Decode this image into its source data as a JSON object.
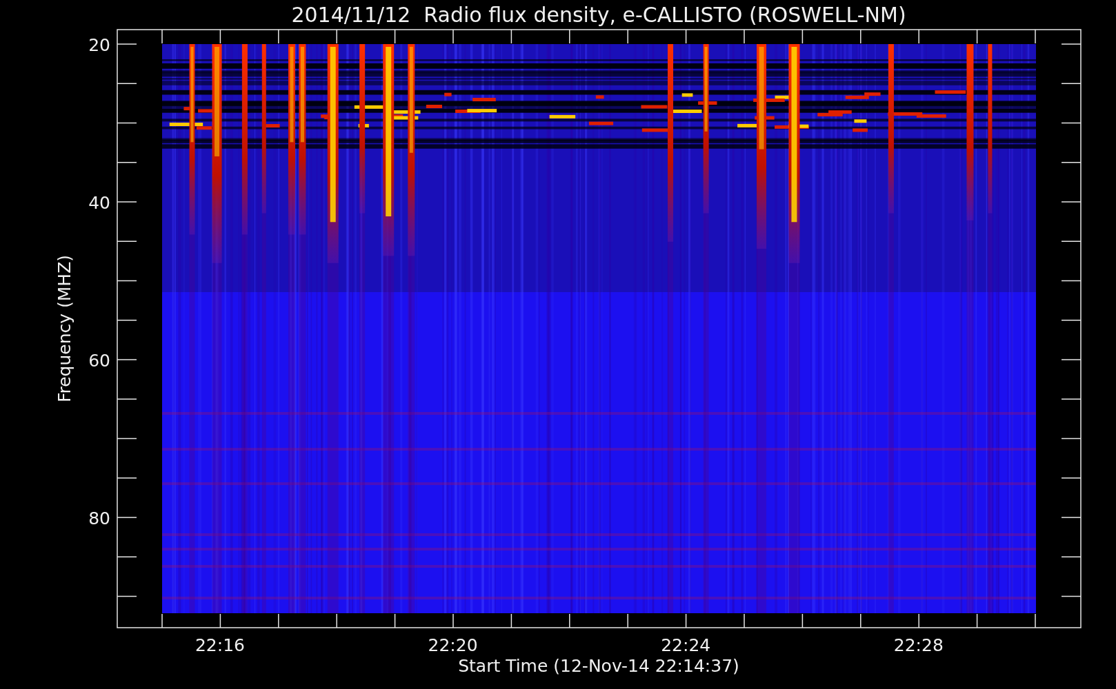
{
  "title": "2014/11/12  Radio flux density, e-CALLISTO (ROSWELL-NM)",
  "y_axis": {
    "label": "Frequency (MHZ)",
    "ticks": [
      "20",
      "40",
      "60",
      "80"
    ]
  },
  "x_axis": {
    "label": "Start Time (12-Nov-14 22:14:37)",
    "ticks": [
      "22:16",
      "22:20",
      "22:24",
      "22:28"
    ]
  }
}
